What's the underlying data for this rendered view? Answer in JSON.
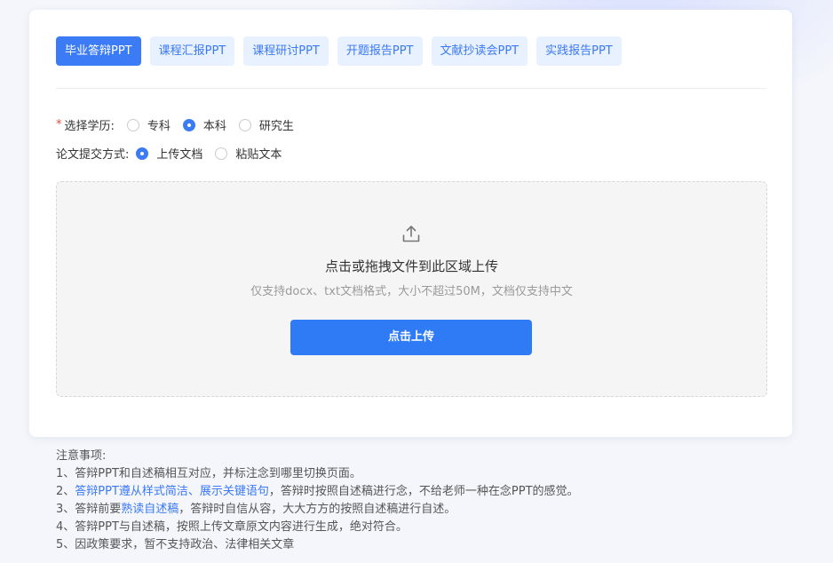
{
  "tabs": [
    {
      "label": "毕业答辩PPT",
      "active": true
    },
    {
      "label": "课程汇报PPT"
    },
    {
      "label": "课程研讨PPT"
    },
    {
      "label": "开题报告PPT"
    },
    {
      "label": "文献抄读会PPT"
    },
    {
      "label": "实践报告PPT"
    }
  ],
  "education": {
    "required_mark": "*",
    "label": "选择学历:",
    "options": [
      "专科",
      "本科",
      "研究生"
    ],
    "selected": "本科"
  },
  "submission": {
    "label": "论文提交方式:",
    "options": [
      "上传文档",
      "粘贴文本"
    ],
    "selected": "上传文档"
  },
  "upload": {
    "icon": "upload-icon",
    "title": "点击或拖拽文件到此区域上传",
    "hint": "仅支持docx、txt文档格式，大小不超过50M，文档仅支持中文",
    "button_label": "点击上传"
  },
  "notes": {
    "heading": "注意事项:",
    "items": [
      {
        "a": "1、答辩PPT和自述稿相互对应，并标注念到哪里切换页面。",
        "hl": "",
        "b": ""
      },
      {
        "a": "2、",
        "hl": "答辩PPT遵从样式简洁、展示关键语句",
        "b": "，答辩时按照自述稿进行念，不给老师一种在念PPT的感觉。"
      },
      {
        "a": "3、答辩前要",
        "hl": "熟读自述稿",
        "b": "，答辩时自信从容，大大方方的按照自述稿进行自述。"
      },
      {
        "a": "4、答辩PPT与自述稿，按照上传文章原文内容进行生成，绝对符合。",
        "hl": "",
        "b": ""
      },
      {
        "a": "5、因政策要求，暂不支持政治、法律相关文章",
        "hl": "",
        "b": ""
      }
    ]
  },
  "colors": {
    "accent": "#3b7cf6",
    "tab_bg": "#e8f1ff",
    "required": "#f0463c",
    "highlight": "#3b79f5"
  }
}
